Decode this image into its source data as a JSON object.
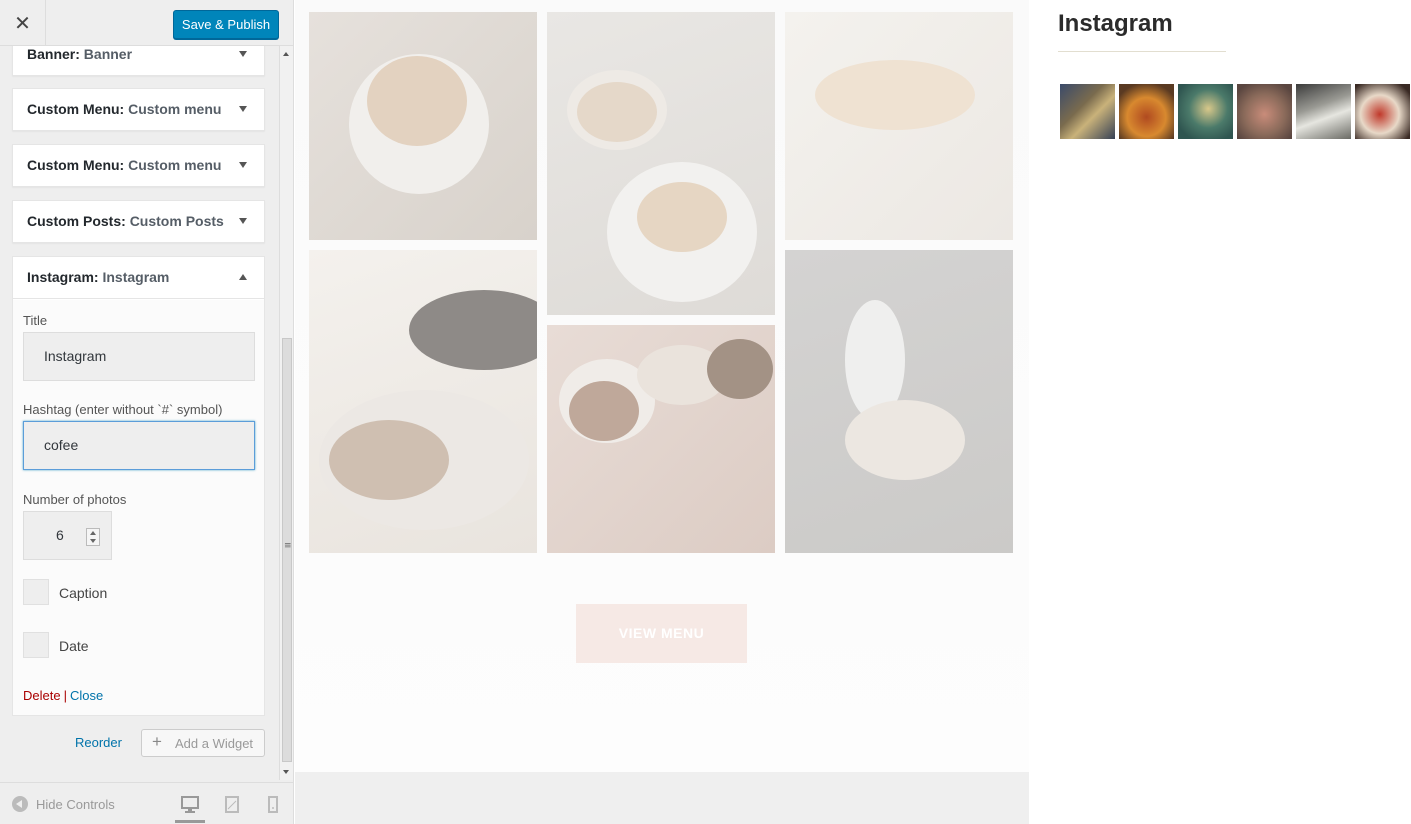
{
  "header": {
    "close_glyph": "✕",
    "publish_label": "Save & Publish"
  },
  "widgets": [
    {
      "type": "Banner:",
      "name": "Banner"
    },
    {
      "type": "Custom Menu:",
      "name": "Custom menu"
    },
    {
      "type": "Custom Menu:",
      "name": "Custom menu"
    },
    {
      "type": "Custom Posts:",
      "name": "Custom Posts"
    }
  ],
  "instagram_widget": {
    "type": "Instagram:",
    "name": "Instagram",
    "title_label": "Title",
    "title_value": "Instagram",
    "hashtag_label": "Hashtag (enter without `#` symbol)",
    "hashtag_value": "cofee",
    "photos_label": "Number of photos",
    "photos_value": "6",
    "caption_label": "Caption",
    "date_label": "Date",
    "delete_label": "Delete",
    "separator": "|",
    "close_label": "Close"
  },
  "actions": {
    "reorder_label": "Reorder",
    "add_widget_label": "Add a Widget"
  },
  "footer": {
    "hide_controls_label": "Hide Controls"
  },
  "preview": {
    "button_label": "VIEW MENU",
    "instagram_title": "Instagram"
  },
  "colors": {
    "accent": "#0085ba",
    "link": "#0073aa",
    "delete": "#aa0000"
  }
}
